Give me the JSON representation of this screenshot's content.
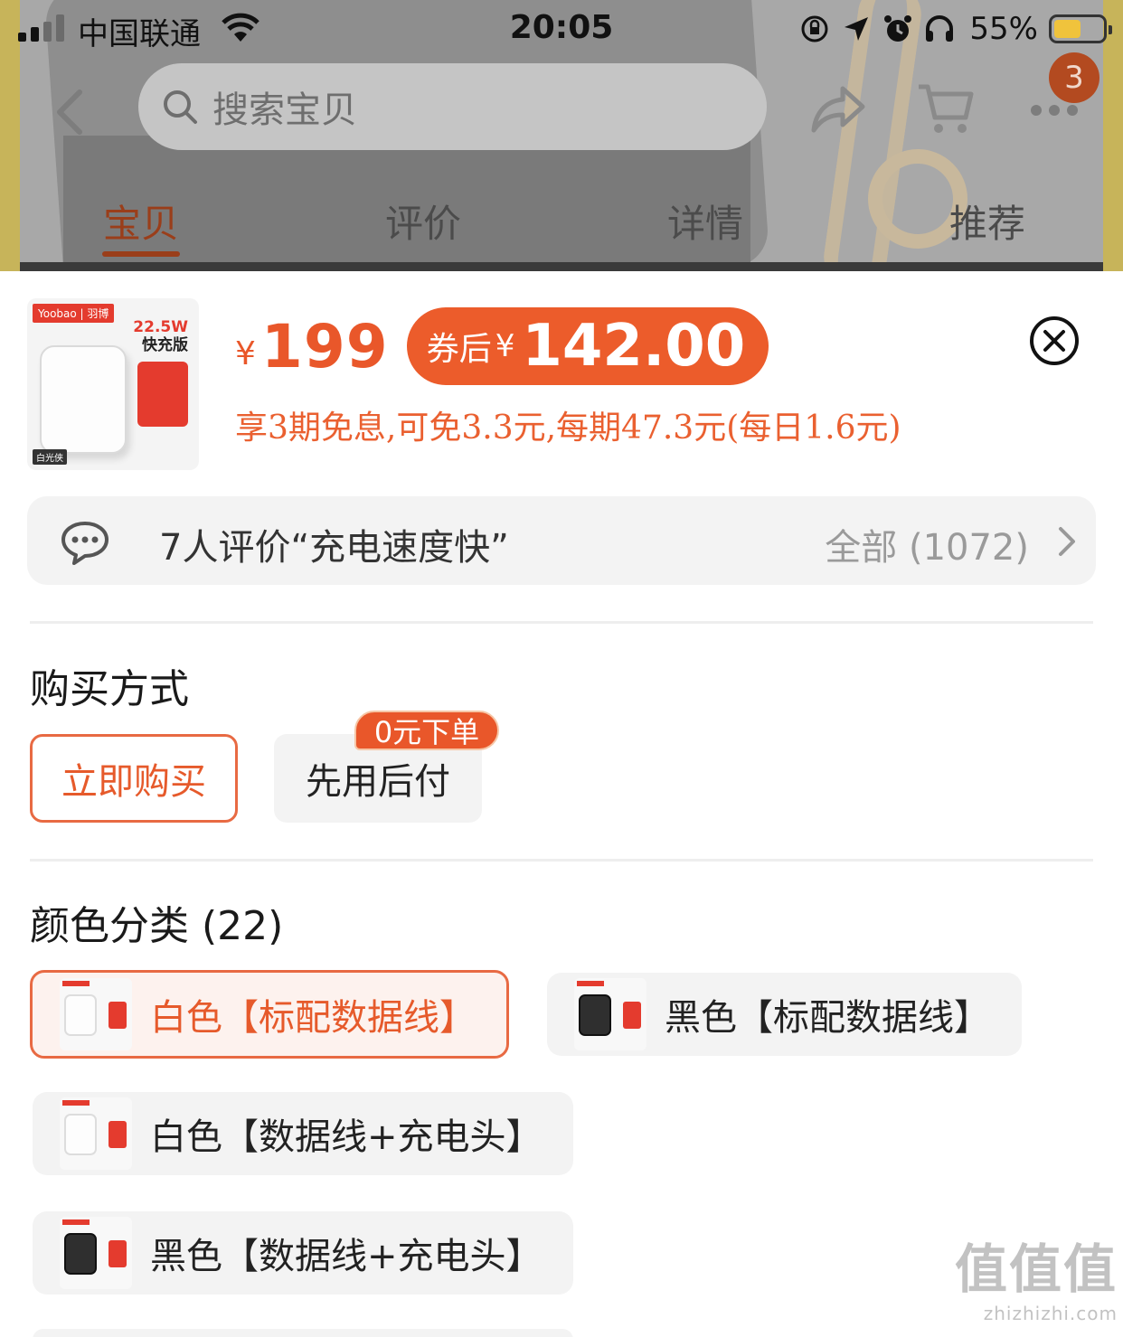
{
  "status_bar": {
    "carrier": "中国联通",
    "time": "20:05",
    "battery_percent": "55%",
    "battery_level": 0.55
  },
  "nav": {
    "search_placeholder": "搜索宝贝",
    "cart_count": "3",
    "icons": [
      "back-icon",
      "search-icon",
      "share-icon",
      "cart-icon",
      "more-icon"
    ]
  },
  "tabs": [
    {
      "label": "宝贝",
      "active": true
    },
    {
      "label": "评价",
      "active": false
    },
    {
      "label": "详情",
      "active": false
    },
    {
      "label": "推荐",
      "active": false
    }
  ],
  "product": {
    "thumb_brand": "Yoobao | 羽博",
    "thumb_spec": "22.5W",
    "thumb_spec_sub": "快充版",
    "thumb_tag": "白光侠",
    "currency": "¥",
    "price": "199",
    "coupon_label": "券后",
    "coupon_currency": "¥",
    "coupon_price": "142.00",
    "installment_text": "享3期免息,可免3.3元,每期47.3元(每日1.6元)"
  },
  "reviews": {
    "highlight": "7人评价“充电速度快”",
    "all_label": "全部 (1072)"
  },
  "purchase": {
    "title": "购买方式",
    "options": [
      {
        "label": "立即购买",
        "selected": true
      },
      {
        "label": "先用后付",
        "selected": false,
        "badge": "0元下单"
      }
    ]
  },
  "color": {
    "title": "颜色分类 (22)",
    "options": [
      {
        "label": "白色【标配数据线】",
        "selected": true,
        "variant": "white"
      },
      {
        "label": "黑色【标配数据线】",
        "selected": false,
        "variant": "black"
      },
      {
        "label": "白色【数据线+充电头】",
        "selected": false,
        "variant": "white"
      },
      {
        "label": "黑色【数据线+充电头】",
        "selected": false,
        "variant": "black"
      }
    ]
  },
  "watermark": {
    "title": "值值值",
    "site": "zhizhizhi.com"
  },
  "colors": {
    "accent": "#E9572A",
    "selected_border": "#E86A43",
    "chip_bg": "#F3F3F3"
  }
}
